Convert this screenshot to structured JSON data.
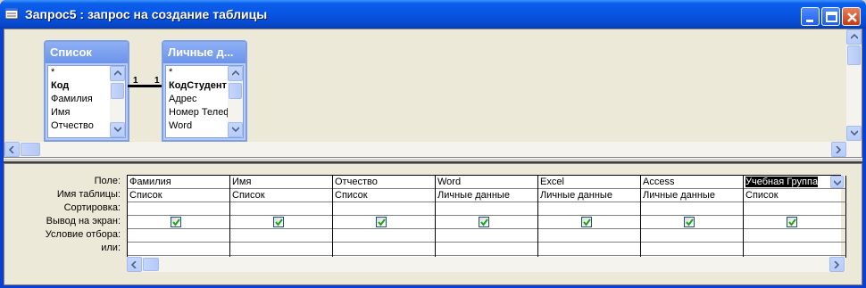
{
  "window": {
    "title": "Запрос5 : запрос на создание таблицы"
  },
  "tables": [
    {
      "title": "Список",
      "fields": [
        {
          "label": "*",
          "bold": false
        },
        {
          "label": "Код",
          "bold": true
        },
        {
          "label": "Фамилия",
          "bold": false
        },
        {
          "label": "Имя",
          "bold": false
        },
        {
          "label": "Отчество",
          "bold": false
        }
      ]
    },
    {
      "title": "Личные д...",
      "fields": [
        {
          "label": "*",
          "bold": false
        },
        {
          "label": "КодСтудент",
          "bold": true
        },
        {
          "label": "Адрес",
          "bold": false
        },
        {
          "label": "Номер Телеф",
          "bold": false
        },
        {
          "label": "Word",
          "bold": false
        }
      ]
    }
  ],
  "relationship": {
    "left_label": "1",
    "right_label": "1"
  },
  "grid": {
    "row_labels": [
      "Поле:",
      "Имя таблицы:",
      "Сортировка:",
      "Вывод на экран:",
      "Условие отбора:",
      "или:"
    ],
    "columns": [
      {
        "field": "Фамилия",
        "table": "Список",
        "show": true
      },
      {
        "field": "Имя",
        "table": "Список",
        "show": true
      },
      {
        "field": "Отчество",
        "table": "Список",
        "show": true
      },
      {
        "field": "Word",
        "table": "Личные данные",
        "show": true
      },
      {
        "field": "Excel",
        "table": "Личные данные",
        "show": true
      },
      {
        "field": "Access",
        "table": "Личные данные",
        "show": true
      },
      {
        "field": "Учебная Группа",
        "table": "Список",
        "show": true
      }
    ]
  }
}
